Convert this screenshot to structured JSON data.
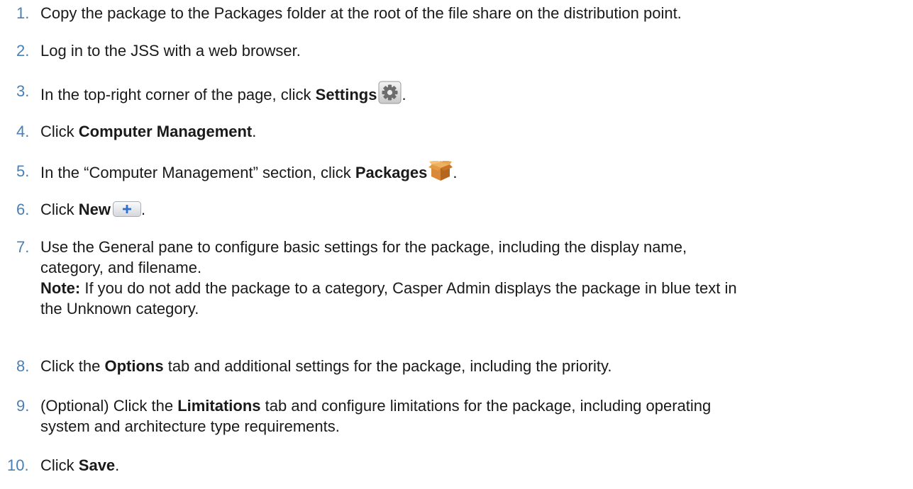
{
  "steps": [
    {
      "number": "1.",
      "text": "Copy the package to the Packages folder at the root of the file share on the distribution point."
    },
    {
      "number": "2.",
      "text": "Log in to the JSS with a web browser."
    },
    {
      "number": "3.",
      "text_before": "In the top-right corner of the page, click ",
      "bold": "Settings",
      "text_after": ".",
      "icon": "gear-icon"
    },
    {
      "number": "4.",
      "text_before": "Click ",
      "bold": "Computer Management",
      "text_after": "."
    },
    {
      "number": "5.",
      "text_before": "In the “Computer Management” section, click ",
      "bold": "Packages",
      "text_after": ".",
      "icon": "package-icon"
    },
    {
      "number": "6.",
      "text_before": "Click ",
      "bold": "New",
      "text_after": ".",
      "icon": "plus-button-icon"
    },
    {
      "number": "7.",
      "line1": "Use the General pane to configure basic settings for the package, including the display name,",
      "line2": "category, and filename.",
      "note_label": "Note:",
      "note_line1": " If you do not add the package to a category, Casper Admin displays the package in blue text in",
      "note_line2": "the Unknown category."
    },
    {
      "number": "8.",
      "text_before": "Click the ",
      "bold": "Options",
      "text_after": " tab and additional settings for the package, including the priority."
    },
    {
      "number": "9.",
      "text_before": "(Optional) Click the ",
      "bold": "Limitations",
      "text_after": " tab and configure limitations for the package, including operating",
      "line2": "system and architecture type requirements."
    },
    {
      "number": "10.",
      "text_before": "Click ",
      "bold": "Save",
      "text_after": "."
    }
  ],
  "colors": {
    "number": "#4a7fb5",
    "text": "#1a1a1a"
  }
}
